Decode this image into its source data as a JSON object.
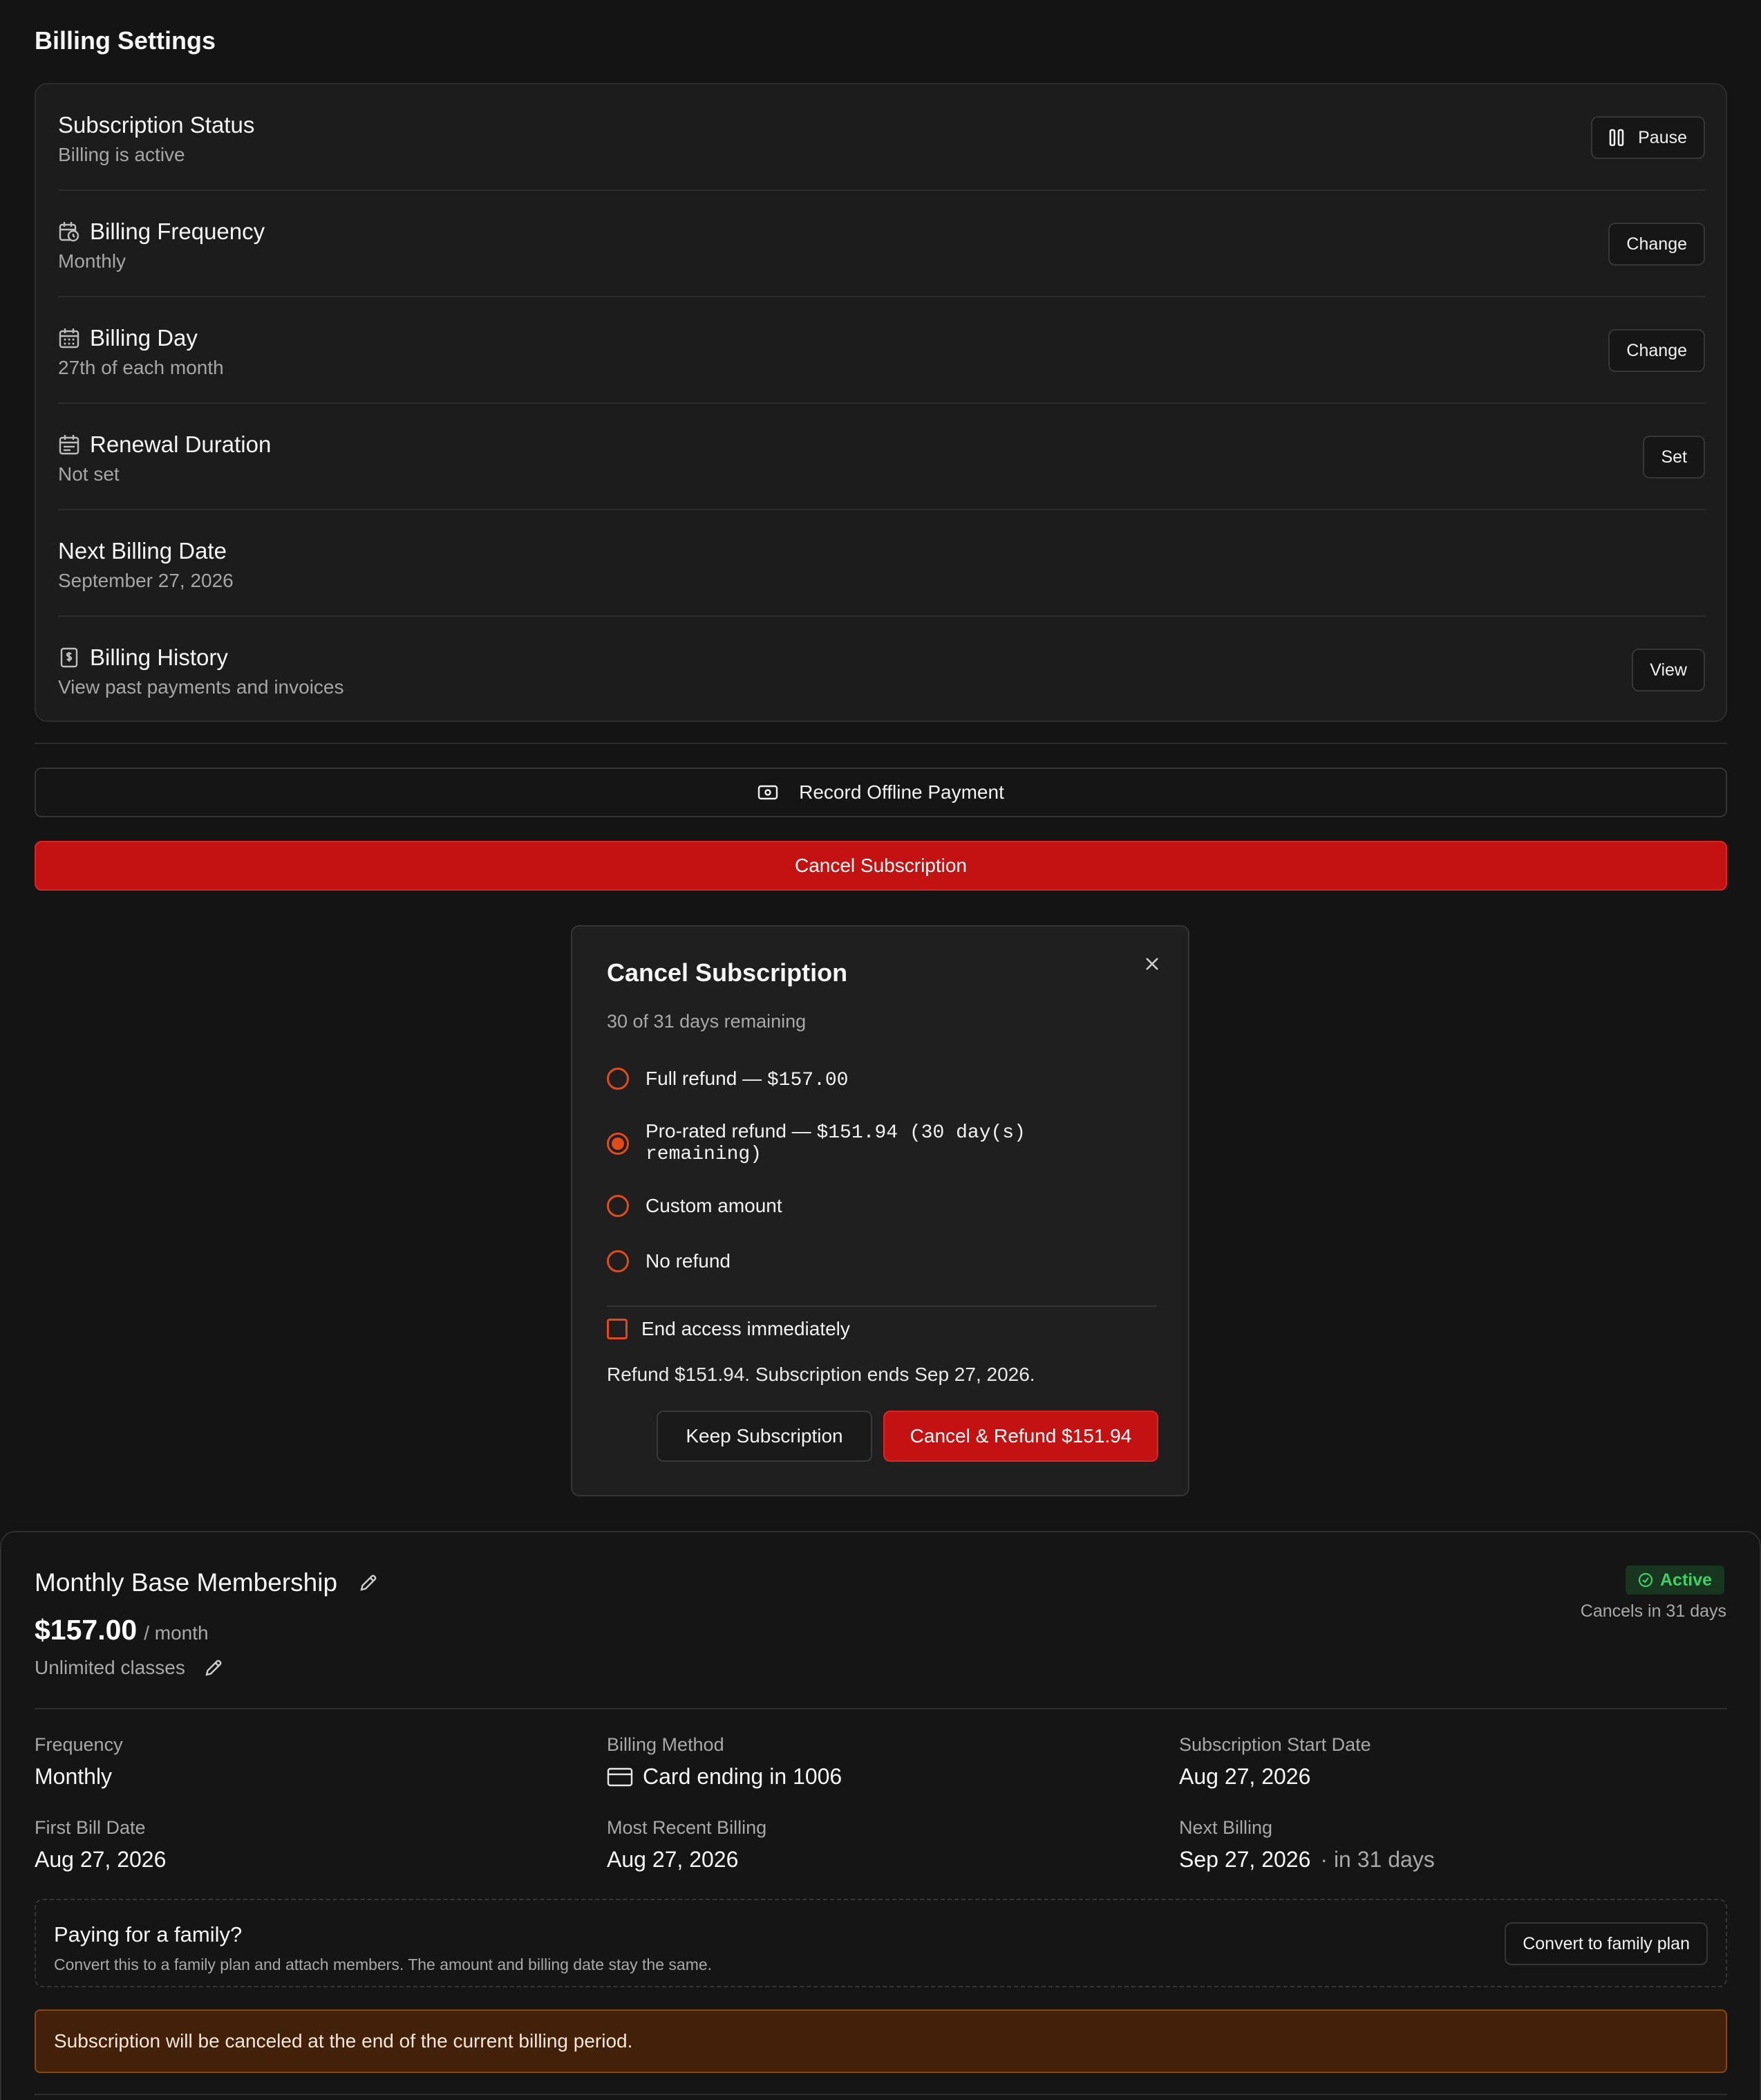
{
  "page": {
    "title": "Billing Settings"
  },
  "settings": {
    "rows": [
      {
        "title": "Subscription Status",
        "subtitle": "Billing is active",
        "icon": "",
        "button": "Pause",
        "button_icon": "pause-icon"
      },
      {
        "title": "Billing Frequency",
        "subtitle": "Monthly",
        "icon": "calendar-clock-icon",
        "button": "Change"
      },
      {
        "title": "Billing Day",
        "subtitle": "27th of each month",
        "icon": "calendar-icon",
        "button": "Change"
      },
      {
        "title": "Renewal Duration",
        "subtitle": "Not set",
        "icon": "calendar-range-icon",
        "button": "Set"
      },
      {
        "title": "Next Billing Date",
        "subtitle": "September 27, 2026",
        "icon": "",
        "button": ""
      },
      {
        "title": "Billing History",
        "subtitle": "View past payments and invoices",
        "icon": "receipt-dollar-icon",
        "button": "View"
      }
    ]
  },
  "actions": {
    "offline_payment": "Record Offline Payment",
    "cancel_subscription": "Cancel Subscription"
  },
  "modal": {
    "title": "Cancel Subscription",
    "subtitle": "30 of 31 days remaining",
    "options": [
      {
        "label": "Full refund — ",
        "mono": "$157.00",
        "selected": false
      },
      {
        "label": "Pro-rated refund — ",
        "mono": "$151.94 (30 day(s) remaining)",
        "selected": true
      },
      {
        "label": "Custom amount",
        "mono": "",
        "selected": false
      },
      {
        "label": "No refund",
        "mono": "",
        "selected": false
      }
    ],
    "end_access_label": "End access immediately",
    "summary": "Refund $151.94. Subscription ends Sep 27, 2026.",
    "keep_label": "Keep Subscription",
    "confirm_label": "Cancel & Refund $151.94"
  },
  "membership": {
    "name": "Monthly Base Membership",
    "price": "$157.00",
    "period": "/ month",
    "description": "Unlimited classes",
    "status": "Active",
    "status_color": "#3ed067",
    "cancels_note": "Cancels in 31 days",
    "fields": {
      "frequency": {
        "label": "Frequency",
        "value": "Monthly"
      },
      "billing_method": {
        "label": "Billing Method",
        "value": "Card ending in 1006"
      },
      "start_date": {
        "label": "Subscription Start Date",
        "value": "Aug 27, 2026"
      },
      "first_bill": {
        "label": "First Bill Date",
        "value": "Aug 27, 2026"
      },
      "recent_billing": {
        "label": "Most Recent Billing",
        "value": "Aug 27, 2026"
      },
      "next_billing": {
        "label": "Next Billing",
        "value": "Sep 27, 2026",
        "suffix": "· in 31 days"
      }
    },
    "family": {
      "title": "Paying for a family?",
      "subtitle": "Convert this to a family plan and attach members. The amount and billing date stay the same.",
      "button": "Convert to family plan"
    },
    "warning": "Subscription will be canceled at the end of the current billing period."
  },
  "colors": {
    "accent": "#c41212",
    "radio": "#e34a1a",
    "warning_bg": "#42200a"
  }
}
